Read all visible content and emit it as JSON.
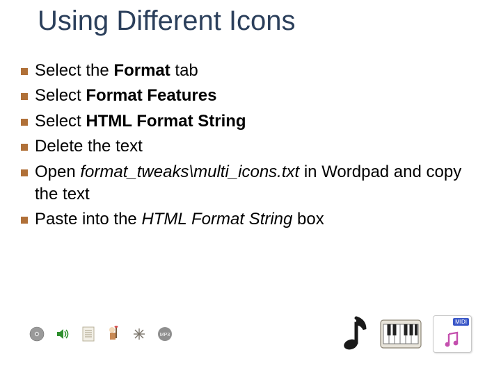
{
  "title": "Using Different Icons",
  "bullets": [
    {
      "pre": "Select the ",
      "bold": "Format",
      "post": " tab"
    },
    {
      "pre": "Select ",
      "bold": "Format Features",
      "post": ""
    },
    {
      "pre": "Select ",
      "bold": "HTML Format String",
      "post": ""
    },
    {
      "pre": "Delete the text",
      "bold": "",
      "post": ""
    },
    {
      "pre": "Open ",
      "italic": "format_tweaks\\multi_icons.txt",
      "post": " in Wordpad and copy the text"
    },
    {
      "pre": "Paste into the ",
      "italic": "HTML Format String",
      "post": " box"
    }
  ],
  "midi_label": "MIDI",
  "colors": {
    "title": "#2b3f5b",
    "bullet": "#b07038"
  }
}
